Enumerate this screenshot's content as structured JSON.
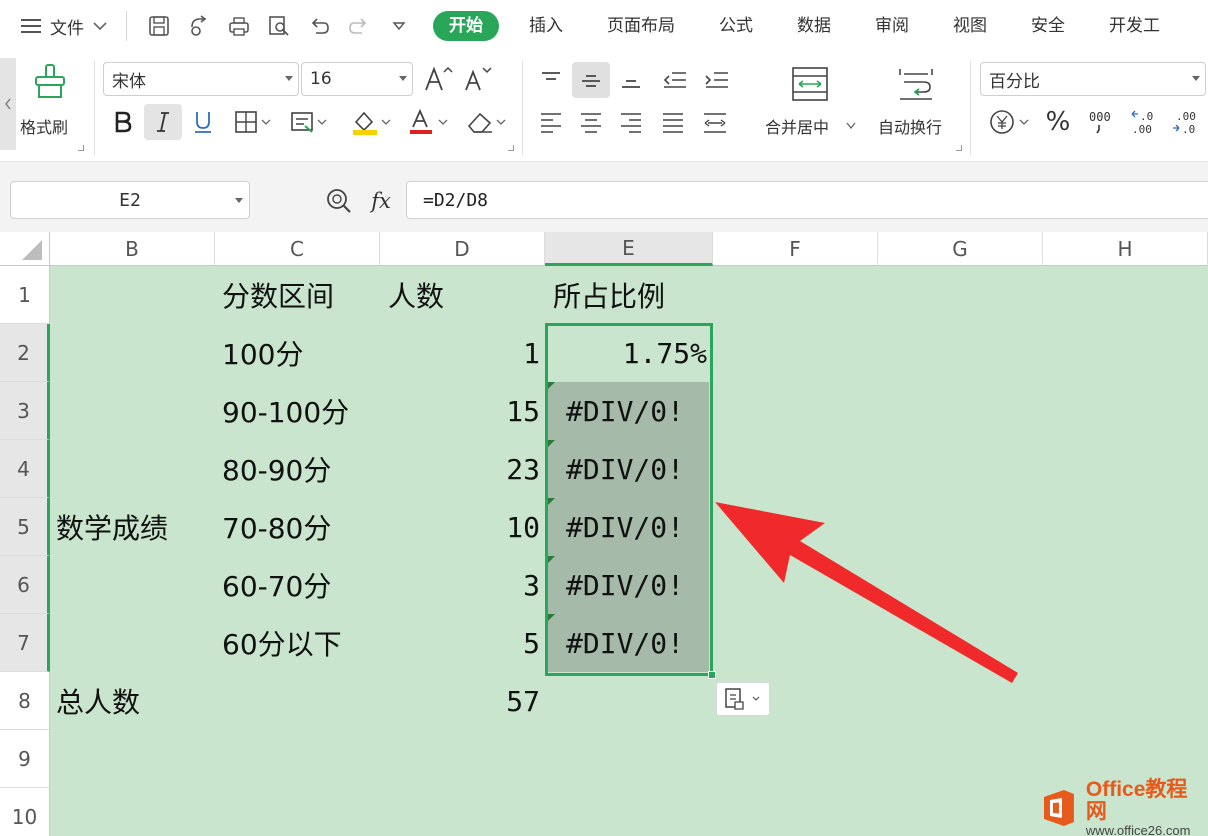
{
  "menubar": {
    "file_label": "文件",
    "tabs": [
      {
        "label": "开始",
        "active": true
      },
      {
        "label": "插入"
      },
      {
        "label": "页面布局"
      },
      {
        "label": "公式"
      },
      {
        "label": "数据"
      },
      {
        "label": "审阅"
      },
      {
        "label": "视图"
      },
      {
        "label": "安全"
      },
      {
        "label": "开发工"
      }
    ]
  },
  "ribbon": {
    "format_painter_label": "格式刷",
    "font_name": "宋体",
    "font_size": "16",
    "merge_center_label": "合并居中",
    "wrap_text_label": "自动换行",
    "number_format": "百分比",
    "percent_symbol": "%"
  },
  "formula_bar": {
    "name_box": "E2",
    "fx_label": "fx",
    "formula": "=D2/D8"
  },
  "sheet": {
    "columns": [
      "B",
      "C",
      "D",
      "E",
      "F",
      "G",
      "H"
    ],
    "rows": [
      "1",
      "2",
      "3",
      "4",
      "5",
      "6",
      "7",
      "8",
      "9",
      "10"
    ],
    "header_row": {
      "interval": "分数区间",
      "count": "人数",
      "ratio": "所占比例"
    },
    "merged_label": "数学成绩",
    "data": [
      {
        "interval": "100分",
        "count": "1",
        "ratio": "1.75%"
      },
      {
        "interval": "90-100分",
        "count": "15",
        "ratio": "#DIV/0!"
      },
      {
        "interval": "80-90分",
        "count": "23",
        "ratio": "#DIV/0!"
      },
      {
        "interval": "70-80分",
        "count": "10",
        "ratio": "#DIV/0!"
      },
      {
        "interval": "60-70分",
        "count": "3",
        "ratio": "#DIV/0!"
      },
      {
        "interval": "60分以下",
        "count": "5",
        "ratio": "#DIV/0!"
      }
    ],
    "total_label": "总人数",
    "total_value": "57"
  },
  "colors": {
    "accent": "#2aa65a",
    "arrow": "#f02a2a",
    "sheet_bg": "#c9e5cd"
  },
  "watermark": {
    "title": "Office教程网",
    "url": "www.office26.com"
  }
}
